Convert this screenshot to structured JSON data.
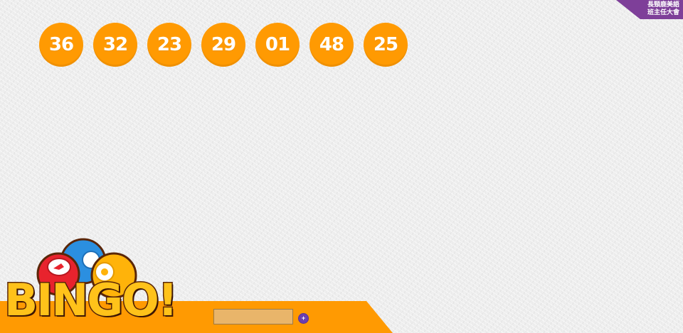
{
  "balls": [
    {
      "number": "36"
    },
    {
      "number": "32"
    },
    {
      "number": "23"
    },
    {
      "number": "29"
    },
    {
      "number": "01"
    },
    {
      "number": "48"
    },
    {
      "number": "25"
    }
  ],
  "ribbon": {
    "line1": "長頸鹿美語",
    "line2": "班主任大會"
  },
  "logo": {
    "text": "BINGO!"
  },
  "controls": {
    "input_value": "",
    "add_label": "+"
  },
  "colors": {
    "ball": "#ff9a02",
    "bar": "#ff9a02",
    "ribbon": "#7e3f99",
    "button": "#6b3fb0",
    "logo_fill": "#ffc21a"
  }
}
